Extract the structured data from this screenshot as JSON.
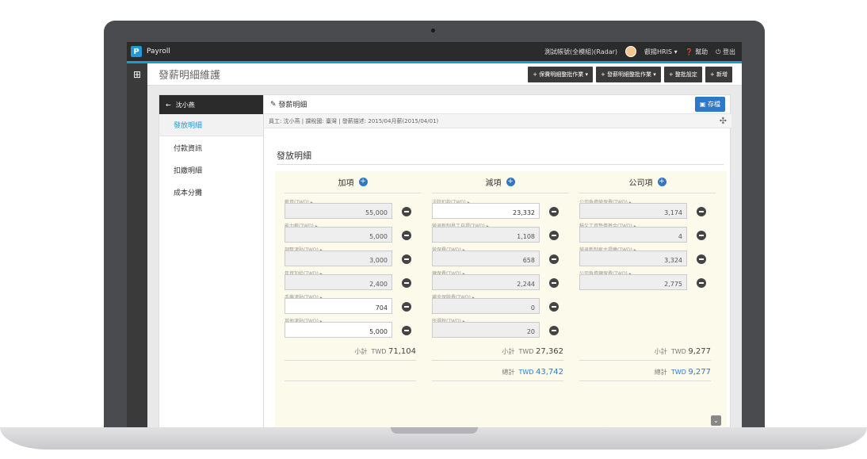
{
  "topbar": {
    "app_name": "Payroll",
    "account": "測試帳號(全模組)(Radar)",
    "menu_hris": "叡揚HRIS ▾",
    "help": "幫助",
    "logout": "登出"
  },
  "header": {
    "title": "發薪明細維護",
    "buttons": [
      "+ 保費明細整批作業 ▾",
      "+ 發薪明細整批作業 ▾",
      "+ 整批設定",
      "+ 新增"
    ]
  },
  "sidebar": {
    "employee": "沈小燕",
    "items": [
      {
        "label": "發放明細",
        "active": true
      },
      {
        "label": "付款資訊",
        "active": false
      },
      {
        "label": "扣繳明細",
        "active": false
      },
      {
        "label": "成本分攤",
        "active": false
      }
    ]
  },
  "content": {
    "title": "發薪明細",
    "save_label": "存檔",
    "info": "員工: 沈小燕 |  課稅國: 臺灣 |  發薪描述: 2015/04月薪(2015/04/01)",
    "section_title": "發放明細",
    "columns": [
      {
        "title": "加項",
        "fields": [
          {
            "label": "薪資(TWD) ▸",
            "value": "55,000",
            "editable": false
          },
          {
            "label": "能力薪(TWD) ▸",
            "value": "5,000",
            "editable": false
          },
          {
            "label": "調整津貼(TWD) ▸",
            "value": "3,000",
            "editable": false
          },
          {
            "label": "年資加給(TWD) ▸",
            "value": "2,400",
            "editable": false
          },
          {
            "label": "手機津貼(TWD) ▸",
            "value": "704",
            "editable": true
          },
          {
            "label": "其他津貼(TWD) ▸",
            "value": "5,000",
            "editable": true
          }
        ],
        "subtotal_label": "小計",
        "subtotal_currency": "TWD",
        "subtotal_value": "71,104"
      },
      {
        "title": "減項",
        "fields": [
          {
            "label": "法院扣款(TWD) ▸",
            "value": "23,332",
            "editable": true
          },
          {
            "label": "勞退新制員工自提(TWD) ▸",
            "value": "1,108",
            "editable": false
          },
          {
            "label": "勞保費(TWD) ▸",
            "value": "658",
            "editable": false
          },
          {
            "label": "健保費(TWD) ▸",
            "value": "2,244",
            "editable": false
          },
          {
            "label": "補充保險費(TWD) ▸",
            "value": "0",
            "editable": false
          },
          {
            "label": "所得稅(TWD) ▸",
            "value": "20",
            "editable": false
          }
        ],
        "subtotal_label": "小計",
        "subtotal_currency": "TWD",
        "subtotal_value": "27,362",
        "total_label": "總計",
        "total_currency": "TWD",
        "total_value": "43,742"
      },
      {
        "title": "公司項",
        "fields": [
          {
            "label": "公司負擔勞保費(TWD) ▸",
            "value": "3,174",
            "editable": false
          },
          {
            "label": "積欠工資墊償基金(TWD) ▸",
            "value": "4",
            "editable": false
          },
          {
            "label": "勞退新制雇主提繳(TWD) ▸",
            "value": "3,324",
            "editable": false
          },
          {
            "label": "公司負擔健保費(TWD) ▸",
            "value": "2,775",
            "editable": false
          }
        ],
        "subtotal_label": "小計",
        "subtotal_currency": "TWD",
        "subtotal_value": "9,277",
        "total_label": "總計",
        "total_currency": "TWD",
        "total_value": "9,277"
      }
    ]
  }
}
